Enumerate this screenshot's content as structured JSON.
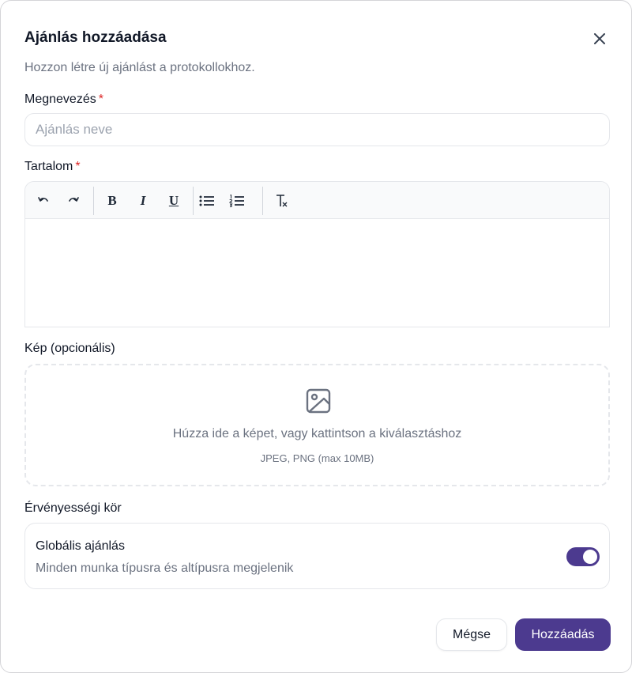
{
  "dialog": {
    "title": "Ajánlás hozzáadása",
    "subtitle": "Hozzon létre új ajánlást a protokollokhoz.",
    "close_icon": "close-icon"
  },
  "name_field": {
    "label": "Megnevezés",
    "required_mark": "*",
    "placeholder": "Ajánlás neve",
    "value": ""
  },
  "content_field": {
    "label": "Tartalom",
    "required_mark": "*",
    "toolbar": {
      "undo_icon": "undo-icon",
      "redo_icon": "redo-icon",
      "bold_label": "B",
      "italic_label": "I",
      "underline_label": "U",
      "bullet_list_icon": "bullet-list-icon",
      "numbered_list_icon": "numbered-list-icon",
      "clear_format_icon": "clear-format-icon"
    },
    "value": ""
  },
  "image_field": {
    "label": "Kép (opcionális)",
    "icon": "image-icon",
    "instruction": "Húzza ide a képet, vagy kattintson a kiválasztáshoz",
    "hint": "JPEG, PNG (max 10MB)"
  },
  "scope": {
    "label": "Érvényességi kör",
    "option_title": "Globális ajánlás",
    "option_description": "Minden munka típusra és altípusra megjelenik",
    "toggle_on": true
  },
  "colors": {
    "accent": "#4c3a8f",
    "required": "#dc2626",
    "muted_text": "#6b7280"
  },
  "actions": {
    "cancel_label": "Mégse",
    "submit_label": "Hozzáadás"
  }
}
